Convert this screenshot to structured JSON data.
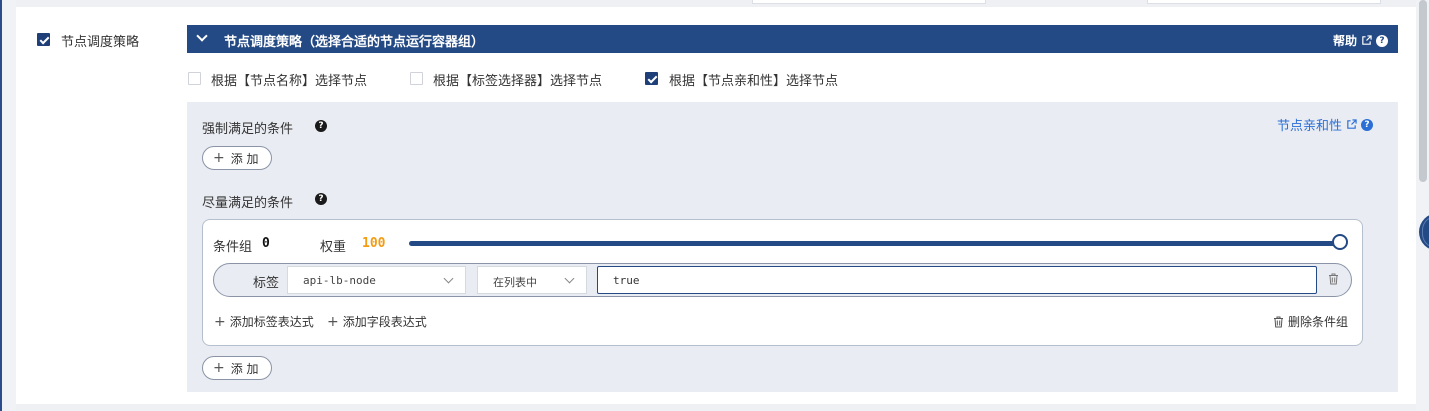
{
  "side_label": "节点调度策略",
  "header": {
    "title": "节点调度策略（选择合适的节点运行容器组）",
    "help_label": "帮助"
  },
  "options": [
    {
      "label": "根据【节点名称】选择节点",
      "checked": false
    },
    {
      "label": "根据【标签选择器】选择节点",
      "checked": false
    },
    {
      "label": "根据【节点亲和性】选择节点",
      "checked": true
    }
  ],
  "required_section": {
    "title": "强制满足的条件",
    "add_label": "添 加"
  },
  "affinity_link": "节点亲和性",
  "preferred_section": {
    "title": "尽量满足的条件",
    "add_label": "添 加"
  },
  "group": {
    "label": "条件组",
    "index": "0",
    "weight_label": "权重",
    "weight_value": "100",
    "weight_level": 1.0,
    "row": {
      "type_label": "标签",
      "key_value": "api-lb-node",
      "operator_value": "在列表中",
      "values_text": "true"
    },
    "add_label_expr": "添加标签表达式",
    "add_field_expr": "添加字段表达式",
    "delete_group": "删除条件组"
  },
  "colors": {
    "primary": "#234a85",
    "accent_orange": "#f39c12",
    "link_blue": "#2b6fd6"
  }
}
